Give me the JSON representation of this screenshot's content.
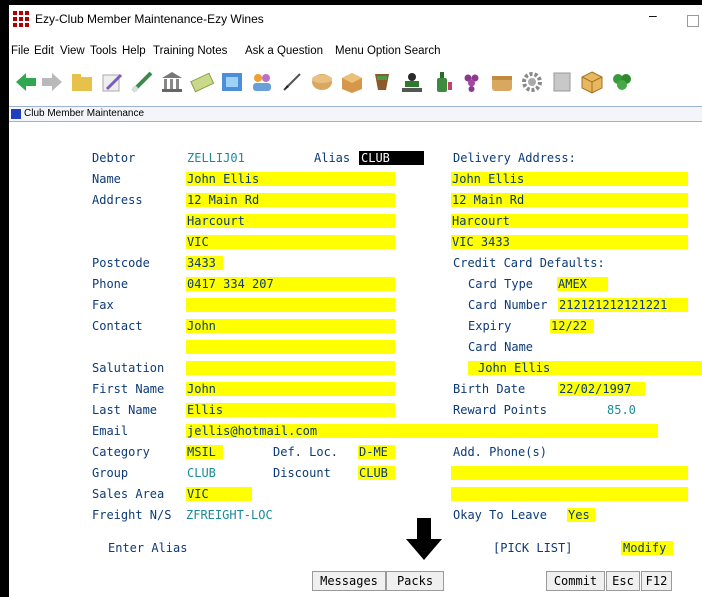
{
  "window": {
    "title": "Ezy-Club Member Maintenance-Ezy Wines",
    "minimize_glyph": "–"
  },
  "menu": {
    "items": [
      "File",
      "Edit",
      "View",
      "Tools",
      "Help",
      "Training Notes",
      "Ask a Question",
      "Menu Option Search"
    ]
  },
  "toolbar": {
    "icons": [
      "back-arrow-icon",
      "forward-arrow-icon",
      "folder-open-icon",
      "edit-icon",
      "pen-icon",
      "bank-icon",
      "money-icon",
      "screen-icon",
      "people-icon",
      "pen-nib-icon",
      "box-round-icon",
      "box-icon",
      "cup-icon",
      "person-tray-icon",
      "bottle-icon",
      "grapes-icon",
      "crate-icon",
      "gear-icon",
      "note-icon",
      "cube-icon",
      "plant-icon"
    ]
  },
  "document": {
    "title": "Club Member Maintenance"
  },
  "form": {
    "debtor": {
      "label": "Debtor",
      "value": "ZELLIJ01"
    },
    "alias": {
      "label": "Alias",
      "value": "CLUB"
    },
    "name": {
      "label": "Name",
      "value": "John Ellis"
    },
    "address": {
      "label": "Address",
      "line1": "12 Main Rd",
      "line2": "Harcourt",
      "line3": "VIC"
    },
    "postcode": {
      "label": "Postcode",
      "value": "3433"
    },
    "phone": {
      "label": "Phone",
      "value": "0417 334 207"
    },
    "fax": {
      "label": "Fax",
      "value": ""
    },
    "contact": {
      "label": "Contact",
      "value": "John",
      "line2": ""
    },
    "salutation": {
      "label": "Salutation",
      "value": ""
    },
    "first_name": {
      "label": "First Name",
      "value": "John"
    },
    "last_name": {
      "label": "Last Name",
      "value": "Ellis"
    },
    "email": {
      "label": "Email",
      "value": "jellis@hotmail.com"
    },
    "category": {
      "label": "Category",
      "value": "MSIL"
    },
    "def_loc": {
      "label": "Def. Loc.",
      "value": "D-ME"
    },
    "group": {
      "label": "Group",
      "value": "CLUB"
    },
    "discount": {
      "label": "Discount",
      "value": "CLUB"
    },
    "sales_area": {
      "label": "Sales Area",
      "value": "VIC"
    },
    "freight": {
      "label": "Freight N/S",
      "value": "ZFREIGHT-LOC"
    },
    "delivery": {
      "label": "Delivery Address:",
      "line1": "John Ellis",
      "line2": "12 Main Rd",
      "line3": "Harcourt",
      "line4": "VIC 3433"
    },
    "credit_card": {
      "label": "Credit Card Defaults:",
      "card_type_label": "Card Type",
      "card_type": "AMEX",
      "card_number_label": "Card Number",
      "card_number": "212121212121221",
      "expiry_label": "Expiry",
      "expiry": "12/22",
      "card_name_label": "Card Name",
      "card_name": "John Ellis"
    },
    "birth_date": {
      "label": "Birth Date",
      "value": "22/02/1997"
    },
    "reward_points": {
      "label": "Reward Points",
      "value": "85.0"
    },
    "add_phone": {
      "label": "Add. Phone(s)",
      "line1": "",
      "line2": ""
    },
    "okay_to_leave": {
      "label": "Okay To Leave",
      "value": "Yes"
    }
  },
  "status": {
    "prompt": "Enter Alias",
    "pick_list": "[PICK LIST]",
    "mode": "Modify"
  },
  "buttons": {
    "messages": "Messages",
    "packs": "Packs",
    "commit": "Commit",
    "esc": "Esc",
    "f12": "F12"
  },
  "colors": {
    "field_highlight": "#ffff00",
    "label_text": "#0c3a78",
    "lookup_text": "#1d8a98",
    "active_field": "#000000"
  }
}
